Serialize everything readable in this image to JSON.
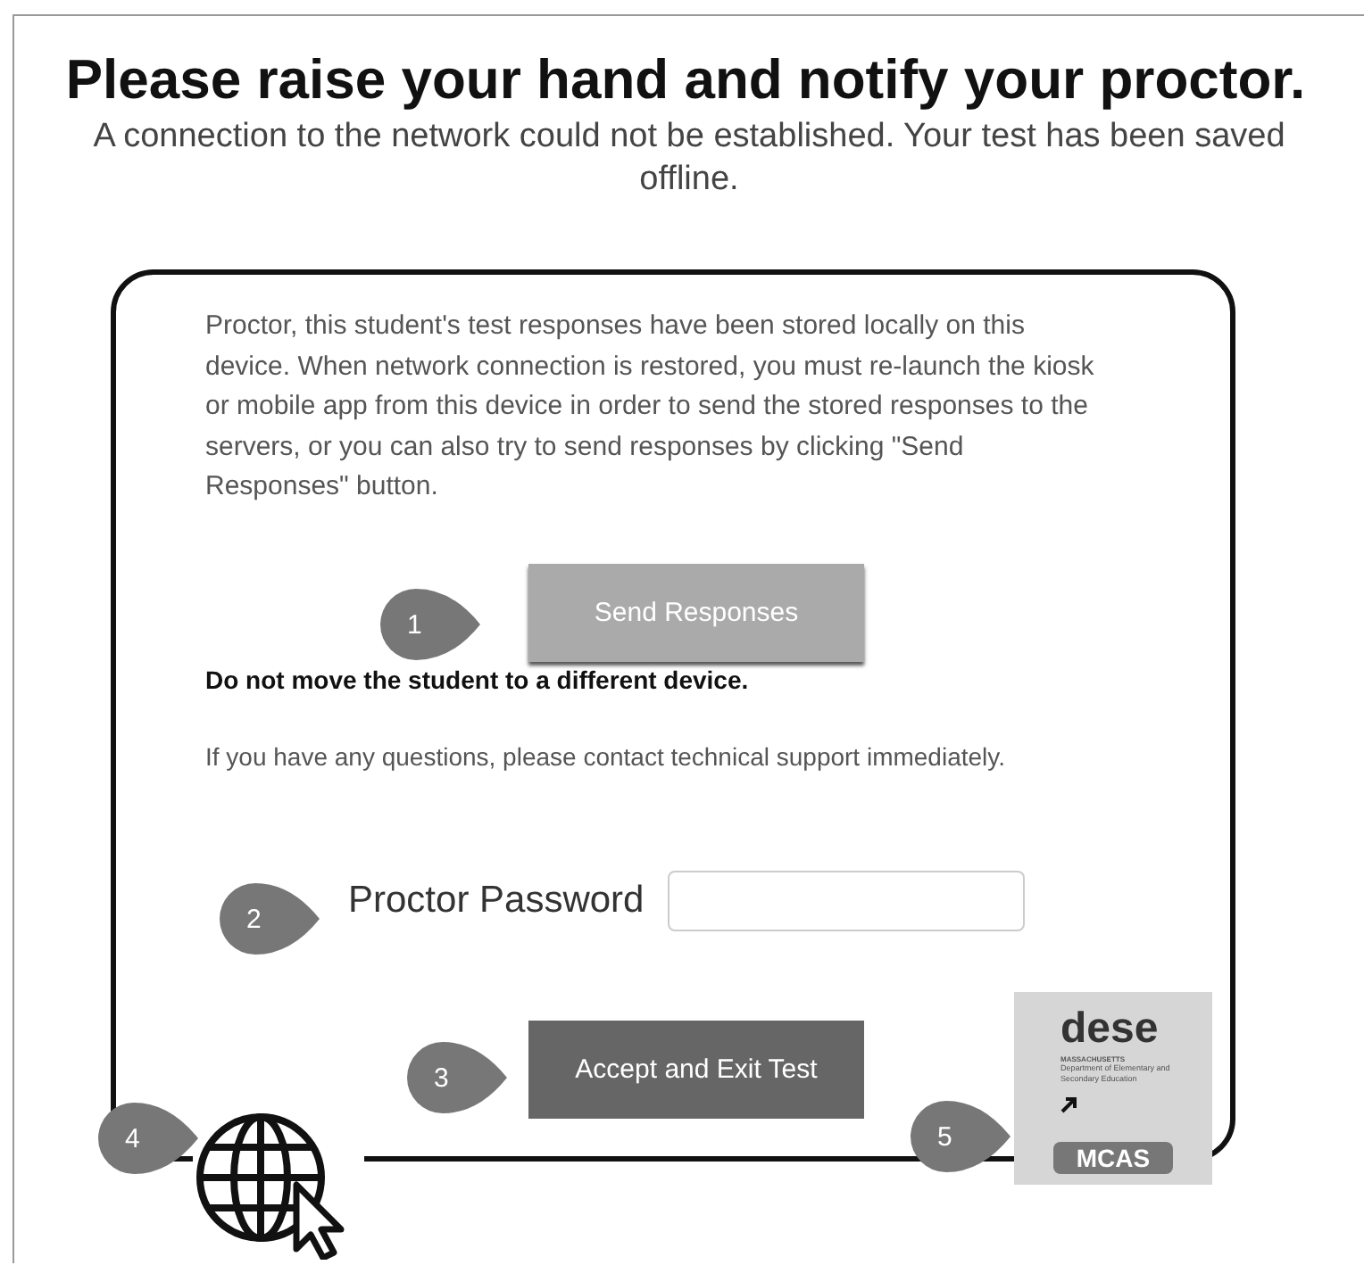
{
  "title": "Please raise your hand and notify your proctor.",
  "subtitle": "A connection to the network could not be established. Your test has been saved offline.",
  "card": {
    "message": "Proctor, this student's test responses have been stored locally on this device. When network connection is restored, you must re-launch the kiosk or mobile app from this device in order to send the stored responses to the servers, or you can also try to send responses by clicking \"Send Responses\" button.",
    "send_button": "Send Responses",
    "warning": "Do not move the student to a different device.",
    "support_note": "If you have any questions, please contact technical support immediately.",
    "password_label": "Proctor Password",
    "accept_button": "Accept and Exit Test"
  },
  "logo": {
    "wordmark": "dese",
    "state": "MASSACHUSETTS",
    "agency": "Department of Elementary and Secondary Education",
    "program": "MCAS"
  },
  "callouts": [
    {
      "label": "1"
    },
    {
      "label": "2"
    },
    {
      "label": "3"
    },
    {
      "label": "4"
    },
    {
      "label": "5"
    }
  ]
}
